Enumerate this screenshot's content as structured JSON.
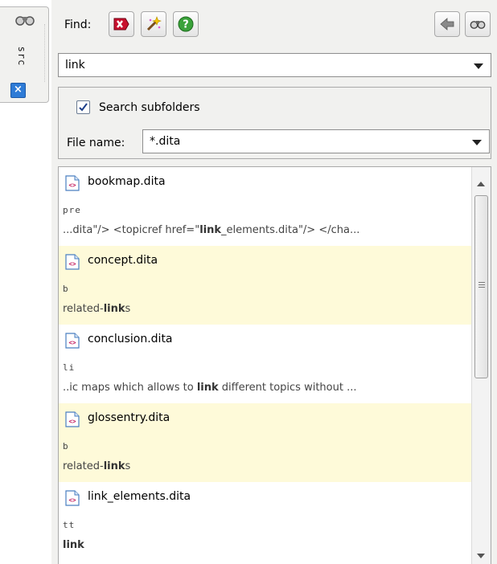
{
  "side_tab": {
    "label": "src",
    "icon": "binoculars-icon",
    "close_icon": "close-icon"
  },
  "toolbar": {
    "find_label": "Find:",
    "buttons": [
      {
        "name": "stop-search-button",
        "icon": "stop-icon"
      },
      {
        "name": "clear-results-button",
        "icon": "magic-wand-icon"
      },
      {
        "name": "help-button",
        "icon": "help-icon"
      },
      {
        "name": "back-button",
        "icon": "back-arrow-icon"
      },
      {
        "name": "find-button",
        "icon": "binoculars-icon"
      }
    ]
  },
  "search": {
    "query": "link"
  },
  "options": {
    "search_subfolders_label": "Search subfolders",
    "search_subfolders_checked": true,
    "file_name_label": "File name:",
    "file_name_value": "*.dita"
  },
  "results": [
    {
      "file": "bookmap.dita",
      "element": "pre",
      "ctx_before": "...dita\"/> <topicref href=\"",
      "match": "link",
      "ctx_after": "_elements.dita\"/> </cha...",
      "highlight": false
    },
    {
      "file": "concept.dita",
      "element": "b",
      "ctx_before": "related-",
      "match": "link",
      "ctx_after": "s",
      "highlight": true
    },
    {
      "file": "conclusion.dita",
      "element": "li",
      "ctx_before": "..ic maps which allows to ",
      "match": "link",
      "ctx_after": " different topics without ...",
      "highlight": false
    },
    {
      "file": "glossentry.dita",
      "element": "b",
      "ctx_before": "related-",
      "match": "link",
      "ctx_after": "s",
      "highlight": true
    },
    {
      "file": "link_elements.dita",
      "element": "tt",
      "ctx_before": "",
      "match": "link",
      "ctx_after": "",
      "highlight": false
    }
  ],
  "colors": {
    "panel_bg": "#f1f1ef",
    "highlight_row": "#fefad9",
    "stop_button_red": "#c8102e",
    "help_button_green": "#3aa23a"
  }
}
